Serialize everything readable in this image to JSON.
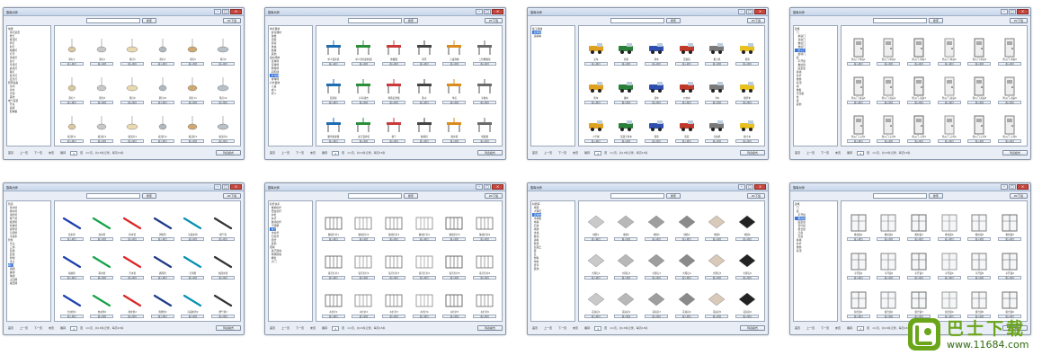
{
  "app": {
    "title": "族库大师",
    "search_button": "搜索",
    "extra_button": "ZC下载",
    "load_label": "载入项目",
    "list_mode": "列表模式",
    "page_of": "页",
    "pager": {
      "first": "首页",
      "prev": "上一页",
      "next": "下一页",
      "last": "末页",
      "jump": "跳转"
    }
  },
  "icons": {
    "minimize": "minimize-icon",
    "maximize": "maximize-icon",
    "close": "close-icon"
  },
  "colors": {
    "title_gradient": "#c8d6ea",
    "close": "#c9473d",
    "selection": "#3875d7",
    "watermark_green": "#6aa51a"
  },
  "windows": [
    {
      "id": "lighting",
      "page": "1",
      "info": "1/1页，共18条记录，每页18条",
      "tree": [
        "常规",
        "  吊灯装置",
        "  壁灯",
        "  吸顶灯",
        "  筒灯",
        "  射灯",
        "  格栅灯",
        "  灯带",
        "  落地灯",
        "  台灯",
        "  草坪灯",
        "  庭院灯",
        "  路灯",
        "  投光灯",
        "  应急灯",
        "照明设备",
        "  室内",
        "  室外",
        "  光源",
        "  其他",
        "电气装置",
        "  开关",
        "  插座",
        "  配电箱"
      ],
      "selected": -1,
      "items": [
        "吊灯1",
        "吊灯2",
        "吊灯3",
        "吊灯4",
        "吊灯5",
        "吊灯6",
        "吊灯7",
        "吊灯8",
        "吊灯9",
        "吊灯10",
        "吊灯11",
        "吊灯12",
        "吸顶灯1",
        "吸顶灯2",
        "吸顶灯3",
        "吸顶灯4",
        "吸顶灯5",
        "吸顶灯6"
      ],
      "thumb": "lamp"
    },
    {
      "id": "sports",
      "page": "1",
      "info": "1/1页，共18条记录，每页18条",
      "tree": [
        "体育器材",
        "  健身器材",
        "  球类",
        "  田径",
        "  游泳",
        "  体操",
        "  器械",
        "  其他",
        "运动场地",
        "  篮球场",
        "  足球场",
        "  网球场",
        "  羽毛球",
        "  乒乓球",
        "  排球场",
        "户外器材",
        "  儿童",
        "  成人",
        "  老人"
      ],
      "selected": 13,
      "items": [
        "单人漫步机",
        "单人坐拉训练器",
        "伸腰器",
        "吊环",
        "儿童滑梯",
        "二位攀爬架",
        "篮球架",
        "乒乓球台",
        "仰卧起坐板",
        "肋木",
        "单杠",
        "平衡木",
        "腰背按摩器",
        "太空漫步机",
        "秋千",
        "健骑机",
        "跑步机",
        "划船器"
      ],
      "thumb": "sport"
    },
    {
      "id": "vehicles",
      "page": "1",
      "info": "1/1页，共18条记录，每页18条",
      "tree": [
        "施工机械",
        "  起重机",
        "  运输车"
      ],
      "selected": 1,
      "items": [
        "叉车",
        "挖机",
        "吊车",
        "压路机",
        "推土机",
        "塔吊",
        "泵车",
        "罐车",
        "货车",
        "公交车",
        "卡车",
        "搅拌车",
        "人字梯",
        "混凝土泵车",
        "塔吊",
        "吊篮",
        "打桩机",
        "推土车"
      ],
      "thumb": "vehicle"
    },
    {
      "id": "doors",
      "page": "1",
      "info": "1/1页，共18条记录，每页18条",
      "tree": [
        "建筑",
        "  门",
        "    单扇门",
        "    双扇门",
        "    推拉门",
        "    卷帘门",
        "    防火门",
        "    旋转门",
        "  窗",
        "    平开窗",
        "    推拉窗",
        "    固定窗",
        "  幕墙",
        "  栏杆",
        "  楼梯",
        "  屋顶",
        "  墙",
        "  楼板",
        "  天花板",
        "  柱",
        "  梁",
        "  其他"
      ],
      "selected": 6,
      "items": [
        "防火门-单扇1",
        "防火门-单扇2",
        "防火门-单扇3",
        "防火门-单扇4",
        "防火门-单扇5",
        "防火门-单扇6",
        "防火门-双扇1",
        "防火门-双扇2",
        "防火门-双扇3",
        "防火门-双扇4",
        "防火门-双扇5",
        "防火门-双扇6",
        "防火门-子母1",
        "防火门-子母2",
        "防火门-子母3",
        "防火门-子母4",
        "防火门-子母5",
        "防火门-子母6"
      ],
      "thumb": "door"
    },
    {
      "id": "pipes",
      "page": "1",
      "info": "1/1页，共18条记录，每页18条",
      "tree": [
        "管道",
        "  给水管",
        "  排水管",
        "  消防管",
        "  燃气管",
        "  暖通管",
        "  喷淋管",
        "  通风管",
        "  空调管",
        "  冷凝水",
        "管件",
        "  弯头",
        "  三通",
        "  四通",
        "  变径",
        "  管帽",
        "  法兰",
        "阀门",
        "  闸阀",
        "  蝶阀",
        "  球阀",
        "  止回阀",
        "  减压阀"
      ],
      "selected": 17,
      "items": [
        "给水管",
        "热水管",
        "排水管",
        "消防管",
        "冷凝水管",
        "燃气管",
        "喷淋管",
        "雨水管",
        "污水管",
        "通风管",
        "空调管",
        "热回水管",
        "给水管2",
        "热水管2",
        "排水管2",
        "消防管2",
        "冷凝水管2",
        "燃气管2"
      ],
      "thumb": "pipe"
    },
    {
      "id": "railings",
      "page": "1",
      "info": "1/1页，共18条记录，每页18条",
      "tree": [
        "栏杆扶手",
        "  楼梯栏杆",
        "  阳台栏杆",
        "  护栏",
        "  扶手",
        "  玻璃栏杆",
        "  不锈钢",
        "  铁艺",
        "  木栏杆",
        "  石栏杆",
        "  组合",
        "  其他",
        "围墙",
        "  铁艺围墙",
        "  砌体围墙",
        "  栅栏",
        "  大门"
      ],
      "selected": 7,
      "items": [
        "玻璃栏杆1",
        "玻璃栏杆2",
        "玻璃栏杆3",
        "玻璃栏杆4",
        "玻璃栏杆5",
        "玻璃栏杆6",
        "铁艺栏杆1",
        "铁艺栏杆2",
        "铁艺栏杆3",
        "铁艺栏杆4",
        "铁艺栏杆5",
        "铁艺栏杆6",
        "木栏杆1",
        "木栏杆2",
        "木栏杆3",
        "木栏杆4",
        "木栏杆5",
        "木栏杆6"
      ],
      "thumb": "rail"
    },
    {
      "id": "floors",
      "page": "1",
      "info": "1/1页，共18条记录，每页18条",
      "tree": [
        "材质库",
        "  地砖",
        "  大理石",
        "  花岗岩",
        "  木地板",
        "  地毯",
        "  石材",
        "  墙砖",
        "  金属",
        "  玻璃",
        "  涂料",
        "  壁纸",
        "  混凝土",
        "  砖",
        "  瓦",
        "  塑料",
        "  布料",
        "  皮革",
        "  其他"
      ],
      "selected": 3,
      "items": [
        "地砖1",
        "地砖2",
        "地砖3",
        "地砖4",
        "地砖5",
        "地砖6",
        "大理石1",
        "大理石2",
        "大理石3",
        "大理石4",
        "大理石5",
        "大理石6",
        "花岗岩1",
        "花岗岩2",
        "花岗岩3",
        "花岗岩4",
        "花岗岩5",
        "花岗岩6"
      ],
      "thumb": "tile"
    },
    {
      "id": "windows",
      "page": "1",
      "info": "1/1页，共18条记录，每页18条",
      "tree": [
        "建筑",
        "  门",
        "  窗",
        "    平开窗",
        "    推拉窗",
        "    固定窗",
        "    百叶窗",
        "    组合窗",
        "    凸窗",
        "    天窗",
        "  幕墙",
        "  栏杆",
        "  楼梯",
        "  屋顶"
      ],
      "selected": 4,
      "items": [
        "推拉窗1",
        "推拉窗2",
        "推拉窗3",
        "推拉窗4",
        "推拉窗5",
        "推拉窗6",
        "平开窗1",
        "平开窗2",
        "平开窗3",
        "平开窗4",
        "平开窗5",
        "平开窗6",
        "组合窗1",
        "组合窗2",
        "组合窗3",
        "组合窗4",
        "组合窗5",
        "组合窗6"
      ],
      "thumb": "window"
    }
  ],
  "watermark": {
    "text": "巴士下载",
    "url": "www.11684.com"
  }
}
